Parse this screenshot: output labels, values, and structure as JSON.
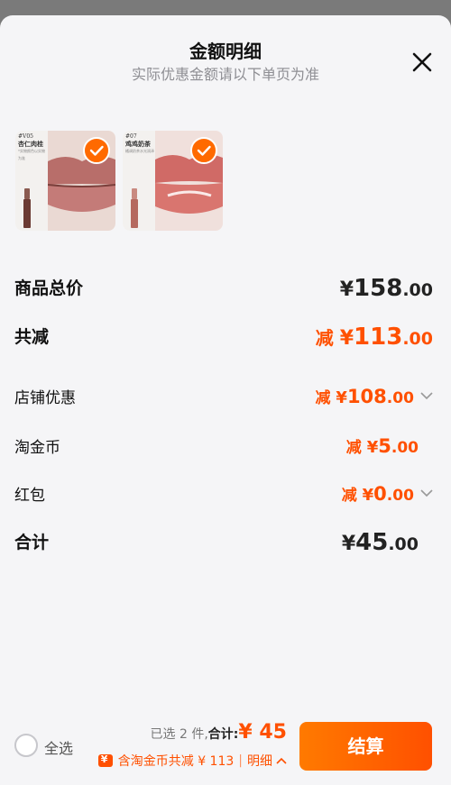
{
  "header": {
    "title": "金额明细",
    "subtitle": "实际优惠金额请以下单页为准"
  },
  "products": [
    {
      "tag_code": "#V05",
      "tag_name": "杏仁肉桂",
      "tag_note": "*实物颜色以实物为准",
      "lip_color": "#c47b78",
      "tube_color": "#6b3a33"
    },
    {
      "tag_code": "#07",
      "tag_name": "鸡鸡奶茶",
      "tag_note": "橘调奶茶水光润泽",
      "lip_color": "#d9756f",
      "tube_color": "#b5695f"
    }
  ],
  "rows": [
    {
      "label": "商品总价",
      "prefix": "",
      "yen": "¥",
      "int": "158",
      "dec": ".00",
      "style": "total",
      "chevron": false
    },
    {
      "label": "共减",
      "prefix": "减 ",
      "yen": "¥",
      "int": "113",
      "dec": ".00",
      "style": "discount-big",
      "chevron": false
    },
    {
      "label": "店铺优惠",
      "prefix": "减 ",
      "yen": "¥",
      "int": "108",
      "dec": ".00",
      "style": "discount",
      "chevron": true
    },
    {
      "label": "淘金币",
      "prefix": "减 ",
      "yen": "¥",
      "int": "5",
      "dec": ".00",
      "style": "discount",
      "chevron": false
    },
    {
      "label": "红包",
      "prefix": "减 ",
      "yen": "¥",
      "int": "0",
      "dec": ".00",
      "style": "discount",
      "chevron": true
    },
    {
      "label": "合计",
      "prefix": "",
      "yen": "¥",
      "int": "45",
      "dec": ".00",
      "style": "total",
      "chevron": false
    }
  ],
  "bottom": {
    "select_all": "全选",
    "selected_count": "已选 2 件,",
    "total_label": "合计:",
    "total_value": "¥ 45",
    "coin_text": "含淘金币共减 ¥ 113",
    "detail_label": "明细",
    "checkout_label": "结算"
  },
  "colors": {
    "accent": "#ff5000",
    "background": "#f5f5f7"
  }
}
